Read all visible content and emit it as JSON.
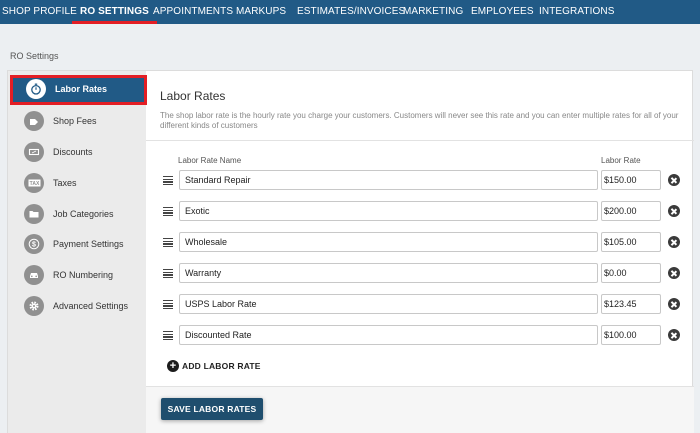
{
  "nav": {
    "tabs": [
      {
        "label": "SHOP PROFILE"
      },
      {
        "label": "RO SETTINGS"
      },
      {
        "label": "APPOINTMENTS"
      },
      {
        "label": "MARKUPS"
      },
      {
        "label": "ESTIMATES/INVOICES"
      },
      {
        "label": "MARKETING"
      },
      {
        "label": "EMPLOYEES"
      },
      {
        "label": "INTEGRATIONS"
      }
    ],
    "active_index": 1
  },
  "page": {
    "section_label": "RO Settings"
  },
  "sidebar": {
    "items": [
      {
        "label": "Labor Rates",
        "icon": "stopwatch-icon"
      },
      {
        "label": "Shop Fees",
        "icon": "fee-tag-icon"
      },
      {
        "label": "Discounts",
        "icon": "coupon-icon"
      },
      {
        "label": "Taxes",
        "icon": "tax-icon"
      },
      {
        "label": "Job Categories",
        "icon": "folder-icon"
      },
      {
        "label": "Payment Settings",
        "icon": "dollar-icon"
      },
      {
        "label": "RO Numbering",
        "icon": "car-icon"
      },
      {
        "label": "Advanced Settings",
        "icon": "gear-icon"
      }
    ],
    "active_index": 0
  },
  "content": {
    "title": "Labor Rates",
    "description": "The shop labor rate is the hourly rate you charge your customers. Customers will never see this rate and you can enter multiple rates for all of your different kinds of customers",
    "col_name": "Labor Rate Name",
    "col_rate": "Labor Rate",
    "rates": [
      {
        "name": "Standard Repair",
        "rate": "$150.00"
      },
      {
        "name": "Exotic",
        "rate": "$200.00"
      },
      {
        "name": "Wholesale",
        "rate": "$105.00"
      },
      {
        "name": "Warranty",
        "rate": "$0.00"
      },
      {
        "name": "USPS Labor Rate",
        "rate": "$123.45"
      },
      {
        "name": "Discounted Rate",
        "rate": "$100.00"
      }
    ],
    "add_label": "ADD LABOR RATE",
    "save_label": "SAVE LABOR RATES"
  },
  "colors": {
    "nav_bg": "#215a86",
    "active_underline": "#e31e24",
    "sidebar_bg": "#ebebeb",
    "save_button": "#1f4e6e"
  }
}
